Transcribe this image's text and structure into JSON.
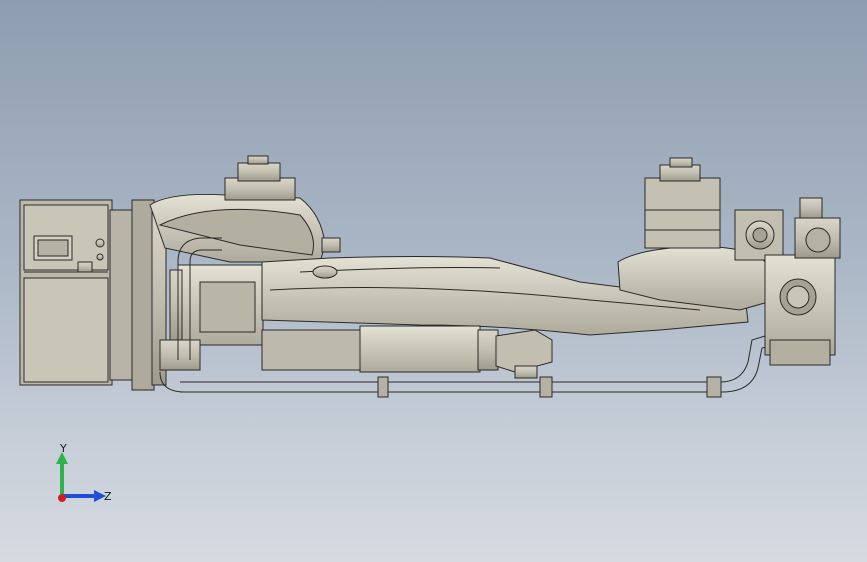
{
  "viewport": {
    "background_top": "#8e9db0",
    "background_bottom": "#d6dbe2"
  },
  "model": {
    "part_color": "#c9c6b8",
    "edge_color": "#2a2a28",
    "shade_color": "#a6a394"
  },
  "triad": {
    "y_label": "Y",
    "z_label": "Z",
    "y_color": "#2db34a",
    "z_color": "#1f4fd8",
    "x_color": "#d11f1f"
  }
}
